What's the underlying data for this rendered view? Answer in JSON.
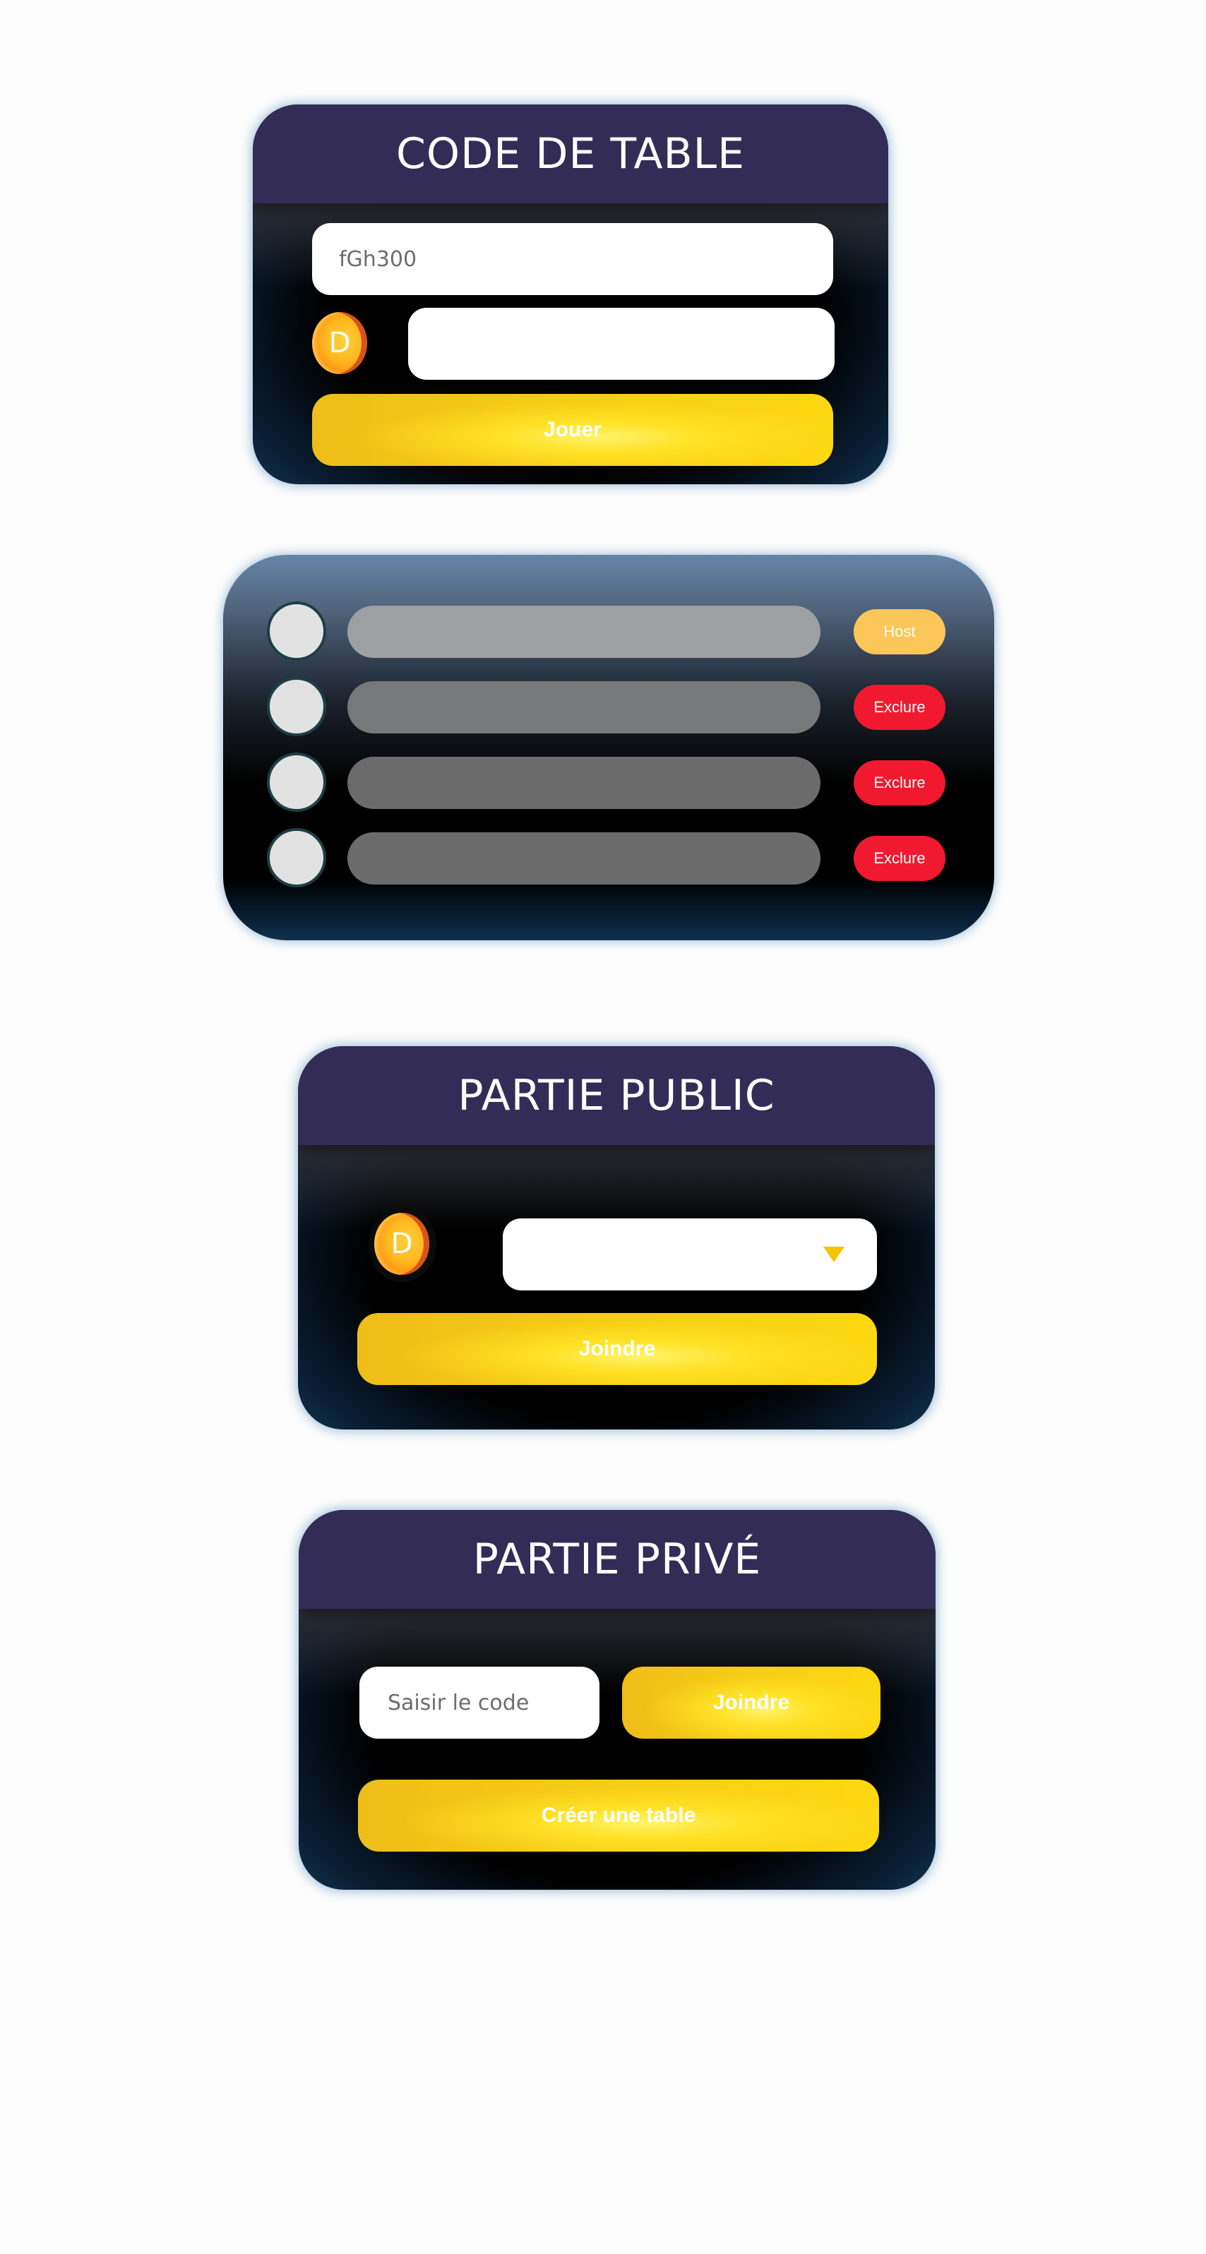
{
  "code_table": {
    "title": "CODE DE TABLE",
    "code_value": "fGh300",
    "coin_letter": "D",
    "amount_value": "",
    "play_button": "Jouer"
  },
  "players": {
    "rows": [
      {
        "role": "Host"
      },
      {
        "role": "Exclure"
      },
      {
        "role": "Exclure"
      },
      {
        "role": "Exclure"
      }
    ]
  },
  "public_game": {
    "title": "PARTIE PUBLIC",
    "coin_letter": "D",
    "stake_selected": "",
    "join_button": "Joindre"
  },
  "private_game": {
    "title": "PARTIE PRIVÉ",
    "code_placeholder": "Saisir le code",
    "join_button": "Joindre",
    "create_button": "Créer une table"
  },
  "colors": {
    "header": "#332c57",
    "accent_yellow": "#fcd414",
    "host_badge": "#fbc759",
    "exclude_badge": "#f0192f"
  }
}
